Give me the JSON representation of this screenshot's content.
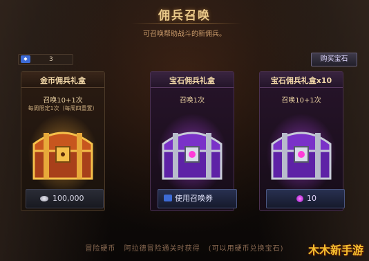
{
  "header": {
    "title": "佣兵召唤",
    "subtitle": "可召唤帮助战斗的新佣兵。"
  },
  "gem_counter": {
    "value": "3",
    "icon": "gem-card-icon"
  },
  "buy_button": "购买宝石",
  "cards": [
    {
      "name": "金币佣兵礼盒",
      "summon": "召唤10+1次",
      "note": "每周限定1次（每周四重置）",
      "price": "100,000",
      "price_icon": "silver-coin-icon",
      "accent": "#f5b84a"
    },
    {
      "name": "宝石佣兵礼盒",
      "summon": "召唤1次",
      "note": "",
      "price": "使用召唤券",
      "price_icon": "summon-ticket-icon",
      "accent": "#b45cff"
    },
    {
      "name": "宝石佣兵礼盒x10",
      "summon": "召唤10+1次",
      "note": "",
      "price": "10",
      "price_icon": "purple-gem-icon",
      "accent": "#b45cff"
    }
  ],
  "footer": {
    "label": "冒险硬币",
    "text": "阿拉德冒险通关时获得",
    "note": "(可以用硬币兑换宝石)"
  },
  "watermark": "木木新手游"
}
